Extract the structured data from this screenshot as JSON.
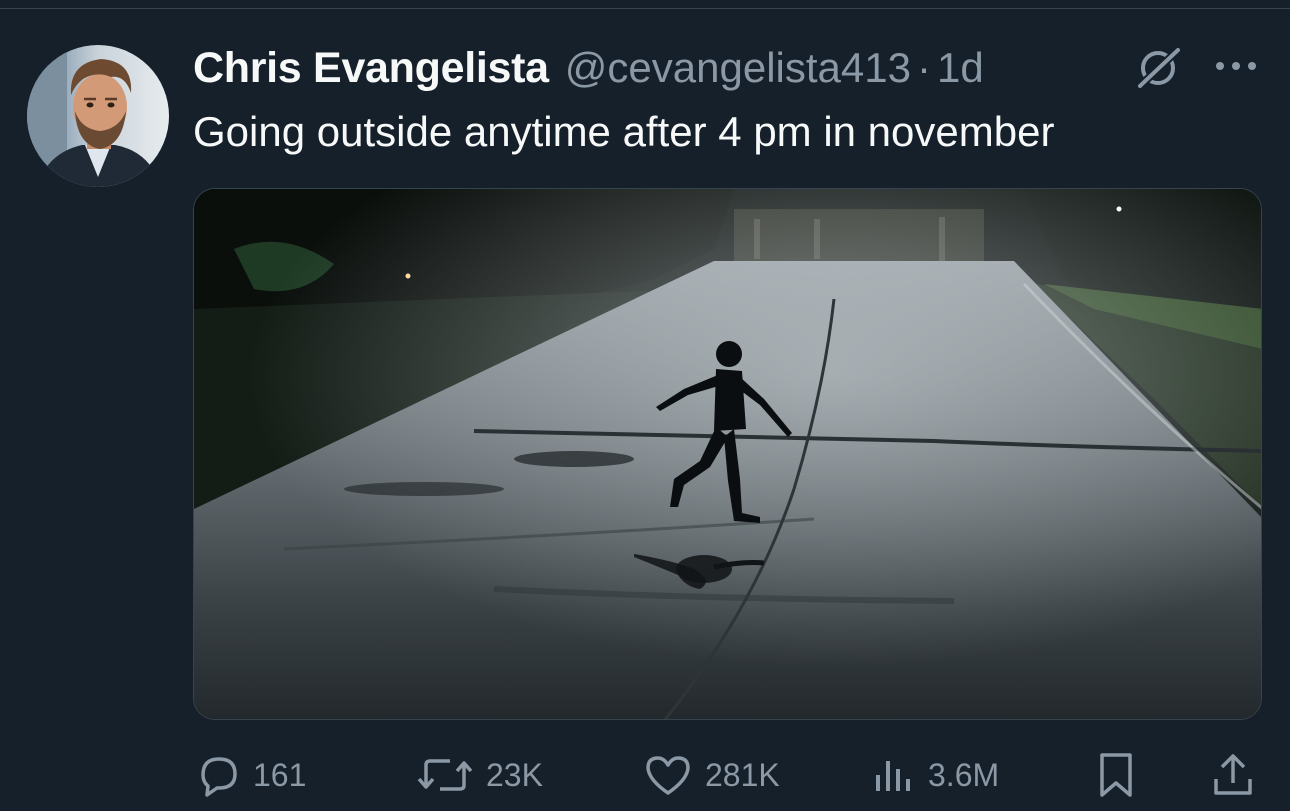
{
  "tweet": {
    "author_name": "Chris Evangelista",
    "handle": "@cevangelista413",
    "separator": "·",
    "time": "1d",
    "text": "Going outside anytime after 4 pm in november"
  },
  "actions": {
    "replies": "161",
    "reposts": "23K",
    "likes": "281K",
    "views": "3.6M"
  },
  "icons": {
    "grok": "grok-icon",
    "more": "more-icon",
    "reply": "reply-icon",
    "repost": "repost-icon",
    "like": "heart-icon",
    "views": "views-icon",
    "bookmark": "bookmark-icon",
    "share": "share-icon"
  },
  "colors": {
    "background": "#15202b",
    "text": "#f7f9f9",
    "secondary_text": "#8b98a5",
    "divider": "#38444d"
  }
}
